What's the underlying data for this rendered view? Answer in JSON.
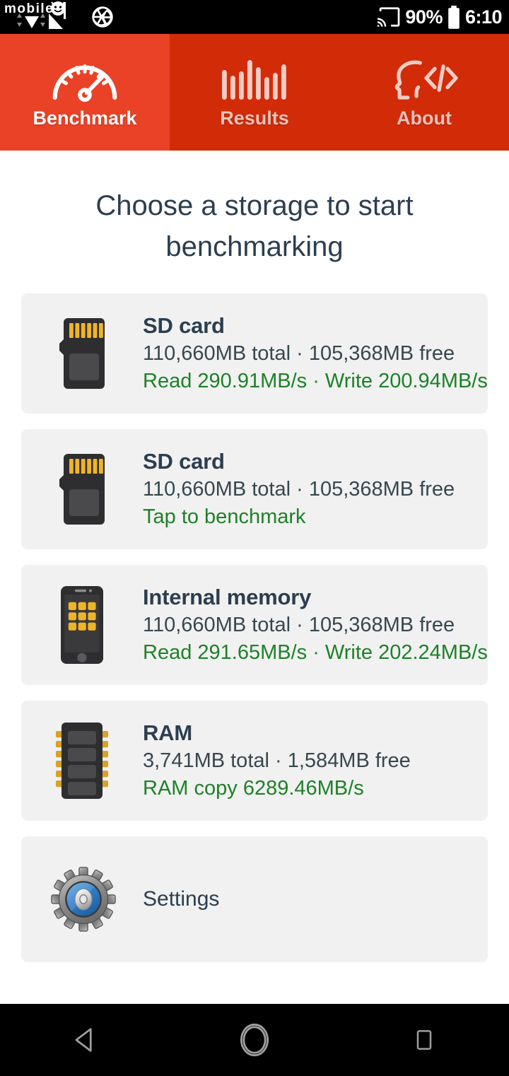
{
  "status_bar": {
    "watermark": "mobile01",
    "watermark_icon": "camera-aperture-icon",
    "cast_icon": "cast-icon",
    "battery_percent": "90%",
    "battery_icon": "battery-icon",
    "time": "6:10"
  },
  "tabs": [
    {
      "label": "Benchmark",
      "icon": "speedometer-icon",
      "active": true
    },
    {
      "label": "Results",
      "icon": "bar-chart-icon",
      "active": false
    },
    {
      "label": "About",
      "icon": "head-code-icon",
      "active": false
    }
  ],
  "main": {
    "heading": "Choose a storage to start benchmarking",
    "cards": [
      {
        "icon": "sd-card-icon",
        "title": "SD card",
        "capacity": "110,660MB total · 105,368MB free",
        "speed": "Read 290.91MB/s · Write 200.94MB/s"
      },
      {
        "icon": "sd-card-icon",
        "title": "SD card",
        "capacity": "110,660MB total · 105,368MB free",
        "speed": "Tap to benchmark"
      },
      {
        "icon": "phone-icon",
        "title": "Internal memory",
        "capacity": "110,660MB total · 105,368MB free",
        "speed": "Read 291.65MB/s · Write 202.24MB/s"
      },
      {
        "icon": "ram-chip-icon",
        "title": "RAM",
        "capacity": "3,741MB total · 1,584MB free",
        "speed": "RAM copy 6289.46MB/s"
      }
    ],
    "settings": {
      "icon": "gear-icon",
      "label": "Settings"
    }
  },
  "nav_bar": {
    "back": "back-triangle-icon",
    "home": "home-circle-icon",
    "recents": "recents-square-icon"
  },
  "colors": {
    "tab_active": "#EA4227",
    "tab_inactive": "#D22B08",
    "heading_text": "#2C3E50",
    "speed_green": "#1E8128",
    "card_bg": "#F1F1F1",
    "page_bg": "#FFFFFF",
    "system_bar": "#000000"
  }
}
